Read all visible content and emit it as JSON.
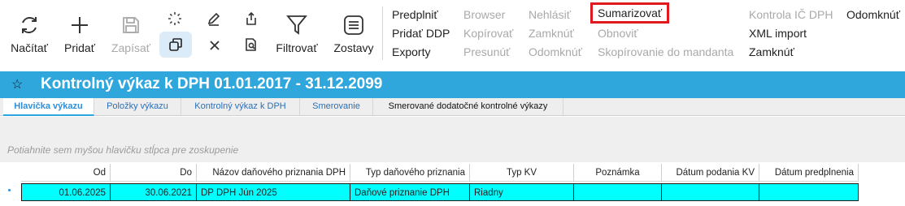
{
  "toolbar": {
    "buttons": {
      "reload": "Načítať",
      "add": "Pridať",
      "save": "Zapísať",
      "filter": "Filtrovať",
      "reports": "Zostavy"
    },
    "menu_col1": [
      "Predplniť",
      "Pridať DDP",
      "Exporty"
    ],
    "menu_col2": [
      "Browser",
      "Kopírovať",
      "Presunúť"
    ],
    "menu_col3": [
      "Nehlásiť",
      "Zamknúť",
      "Odomknúť"
    ],
    "menu_col4": [
      "Sumarizovať",
      "Obnoviť",
      "Skopírovanie do mandanta"
    ],
    "menu_col5": [
      "Kontrola IČ DPH",
      "XML import",
      "Zamknúť"
    ],
    "menu_col6": [
      "Odomknúť"
    ]
  },
  "title_bar": {
    "star": "☆",
    "title": "Kontrolný výkaz k DPH 01.01.2017 - 31.12.2099"
  },
  "tabs": [
    "Hlavička výkazu",
    "Položky výkazu",
    "Kontrolný výkaz k DPH",
    "Smerovanie",
    "Smerované dodatočné kontrolné výkazy"
  ],
  "group_panel": {
    "hint": "Potiahnite sem myšou hlavičku stĺpca pre zoskupenie"
  },
  "grid": {
    "columns": [
      "Od",
      "Do",
      "Názov daňového priznania DPH",
      "Typ daňového priznania",
      "Typ KV",
      "Poznámka",
      "Dátum podania KV",
      "Dátum predplnenia"
    ],
    "rows": [
      {
        "od": "01.06.2025",
        "do": "30.06.2021",
        "nazov": "DP DPH Jún 2025",
        "typ_dp": "Daňové priznanie DPH",
        "typ_kv": "Riadny",
        "poznamka": "",
        "datum_podania": "",
        "datum_predplnenia": ""
      }
    ]
  },
  "colors": {
    "title_bar": "#2fa7dc",
    "selected_row": "#00ffff",
    "highlight_outline": "#e0191f"
  }
}
